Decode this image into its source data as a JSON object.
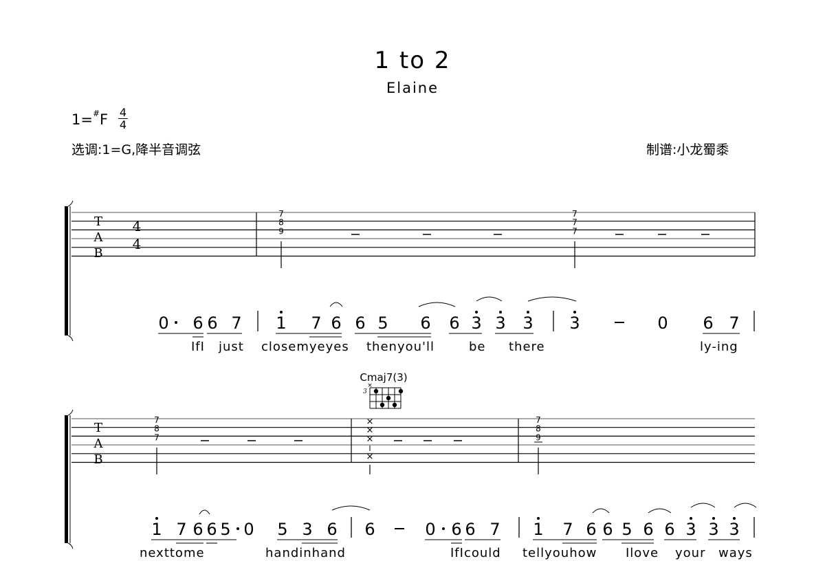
{
  "header": {
    "title": "1 to 2",
    "artist": "Elaine",
    "key_prefix": "1=",
    "key_sharp": "#",
    "key_note": "F",
    "time_signature": {
      "numerator": "4",
      "denominator": "4"
    },
    "tuning_note": "选调:1=G,降半音调弦",
    "transcriber": "制谱:小龙蜀黍"
  },
  "tab_labels": [
    "T",
    "A",
    "B"
  ],
  "systems": [
    {
      "tab_time_signature": [
        "4",
        "4"
      ],
      "measures": [
        {
          "tab": [],
          "rests": []
        },
        {
          "tab": [
            {
              "frets": [
                "7",
                "8",
                "9"
              ],
              "strings": [
                1,
                2,
                3
              ]
            }
          ],
          "rests": [
            "–",
            "–",
            "–"
          ]
        },
        {
          "tab": [
            {
              "frets": [
                "7",
                "7",
                "7"
              ],
              "strings": [
                1,
                2,
                3
              ]
            }
          ],
          "rests": [
            "–",
            "–",
            "–"
          ]
        }
      ],
      "notation": [
        [
          "0·",
          "6",
          "6",
          "7"
        ],
        [
          "1̇",
          "7",
          "6",
          "6",
          "5",
          "6",
          "6",
          "3̇",
          "3̇",
          "3̇"
        ],
        [
          "3̇",
          "–",
          "0",
          "6",
          "7"
        ]
      ],
      "lyrics": [
        "IfI",
        "just",
        "closemyeyes",
        "thenyou'll",
        "be",
        "there",
        "ly-ing"
      ]
    },
    {
      "chord": {
        "name": "Cmaj7(3)",
        "fret_label": "3",
        "muted_marker": "×"
      },
      "measures": [
        {
          "tab": [
            {
              "frets": [
                "7",
                "8",
                "7"
              ],
              "strings": [
                1,
                2,
                3
              ]
            }
          ],
          "rests": [
            "–",
            "–",
            "–"
          ]
        },
        {
          "tab": [
            {
              "frets": [
                "×",
                "×",
                "×",
                "×"
              ],
              "strings": [
                1,
                2,
                3,
                5
              ]
            }
          ],
          "rests": [
            "–",
            "–",
            "–"
          ]
        },
        {
          "tab": [
            {
              "frets": [
                "7",
                "8",
                "9"
              ],
              "strings": [
                1,
                2,
                3
              ]
            }
          ],
          "rests": []
        }
      ],
      "notation": [
        [
          "1̇",
          "7",
          "6",
          "6",
          "5·",
          "0",
          "5",
          "3",
          "6"
        ],
        [
          "6",
          "–",
          "0·",
          "6",
          "6",
          "7"
        ],
        [
          "1̇",
          "7",
          "6",
          "6",
          "5",
          "6",
          "6",
          "3̇",
          "3̇",
          "3̇"
        ]
      ],
      "lyrics": [
        "nexttome",
        "handinhand",
        "IfIcould",
        "tellyouhow",
        "Ilove",
        "your",
        "ways"
      ]
    }
  ]
}
